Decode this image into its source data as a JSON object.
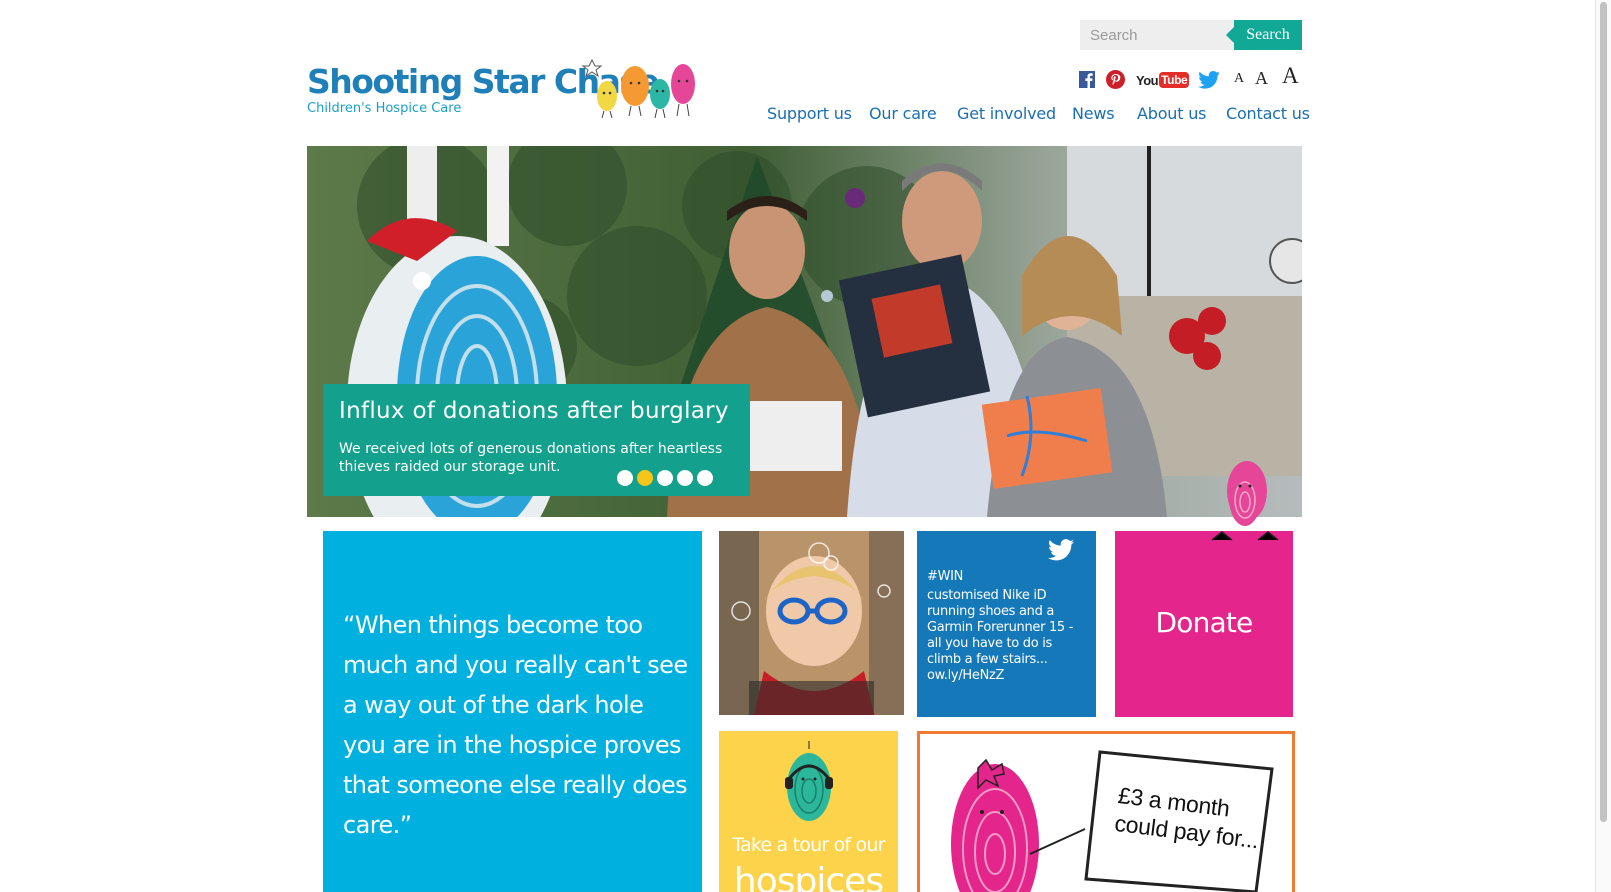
{
  "search": {
    "placeholder": "Search",
    "button_label": "Search"
  },
  "logo": {
    "title": "Shooting Star Chase",
    "subtitle": "Children's Hospice Care"
  },
  "social": {
    "icons": [
      "facebook-icon",
      "pinterest-icon",
      "youtube-icon",
      "twitter-icon"
    ],
    "youtube_label": "You",
    "youtube_tube": "Tube",
    "text_sizes": [
      "A",
      "A",
      "A"
    ]
  },
  "nav": {
    "items": [
      "Support us",
      "Our care",
      "Get involved",
      "News",
      "About us",
      "Contact us"
    ]
  },
  "hero": {
    "title": "Influx of donations after burglary",
    "text": "We received lots of generous donations after heartless thieves raided our storage unit.",
    "slide_count": 5,
    "active_slide": 2
  },
  "tiles": {
    "quote": "“When things become too much and you really can't see a way out of the dark hole you are in the hospice proves that someone else really does care.”",
    "tweet": {
      "hashtag": "#WIN",
      "text": "customised Nike iD running shoes and a Garmin Forerunner 15 - all you have to do is climb a few stairs... ow.ly/HeNzZ"
    },
    "donate": "Donate",
    "tour": {
      "line1": "Take a tour of our",
      "line2": "hospices"
    },
    "promo": "£3 a month could pay for..."
  },
  "colors": {
    "brand_blue": "#1f7fb8",
    "teal": "#13a08c",
    "cyan": "#00b1e0",
    "twitter_blue": "#1578b8",
    "pink": "#e4258b",
    "yellow": "#fcd34a",
    "orange": "#f07a30",
    "dot_active": "#f6c51c"
  }
}
